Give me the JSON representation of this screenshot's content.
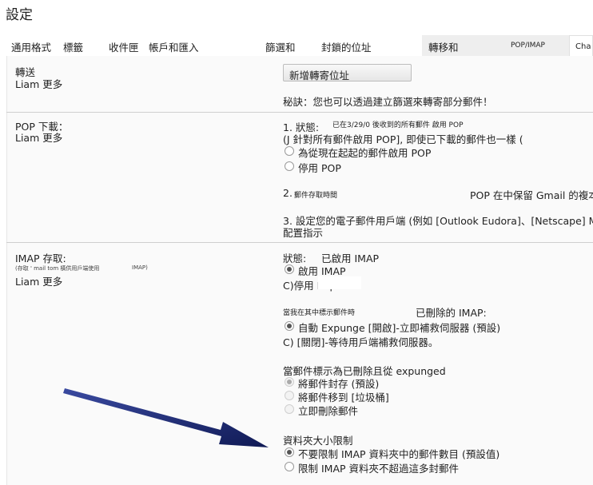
{
  "header": {
    "title": "設定"
  },
  "tabs": [
    {
      "label": "通用格式"
    },
    {
      "label": "標籤"
    },
    {
      "label": "收件匣"
    },
    {
      "label": "帳戶和匯入"
    },
    {
      "label": "篩選和"
    },
    {
      "label": "封鎖的位址"
    },
    {
      "label": "轉移和"
    },
    {
      "label": "POP/IMAP"
    },
    {
      "label": "Cha"
    }
  ],
  "forwarding": {
    "title": "轉送",
    "learn_more": "Liam 更多",
    "add_button": "新增轉寄位址",
    "tip": "秘訣：您也可以透過建立篩選來轉寄部分郵件！"
  },
  "pop": {
    "title": "POP 下載：",
    "learn_more": "Liam 更多",
    "step1_label": "1. 狀態:",
    "step1_status": "已在3/29/0 後收到的所有郵件 啟用 POP",
    "opt_all": "(J 針對所有郵件啟用 POP], 即使已下載的郵件也一樣 (",
    "opt_now": "為從現在起起的郵件啟用 POP",
    "opt_disable": "停用 POP",
    "step2_label": "2.",
    "step2_text": "郵件存取時間",
    "step2_keep": "POP 在中保留 Gmail 的複本",
    "step3_line1": "3. 設定您的電子郵件用戶端 (例如 [Outlook Eudora]、[Netscape] M;",
    "step3_line2": "配置指示"
  },
  "imap": {
    "title": "IMAP 存取:",
    "subtitle": "(存取 ' mail tom 橫供用戶端使用",
    "subtitle_end": "IMAP)",
    "learn_more": "Liam 更多",
    "status_label": "狀態:",
    "status_value": "已啟用 IMAP",
    "opt_enable": "啟用 IMAP",
    "opt_disable": "C)停用 Imp",
    "expunge_title_left": "當我在其中標示郵件時",
    "expunge_title_right": "已刪除的 IMAP:",
    "expunge_on": "自動 Expunge [開啟]-立即補救伺服器 (預設)",
    "expunge_off": "C) [關閉]-等待用戶端補救伺服器。",
    "deleted_title": "當郵件標示為已刪除且從 expunged",
    "deleted_archive": "將郵件封存 (預設)",
    "deleted_trash": "將郵件移到 [垃圾桶]",
    "deleted_now": "立即刪除郵件",
    "folder_title": "資料夾大小限制",
    "folder_nolimit": "不要限制 IMAP 資料夾中的郵件數目 (預設值)",
    "folder_limit": "限制 IMAP 資料夾不超過這多封郵件"
  },
  "colors": {
    "pane_bg": "#fafafa",
    "arrow": "#1e2a6e",
    "tab_active_bg": "#eeeeee"
  }
}
